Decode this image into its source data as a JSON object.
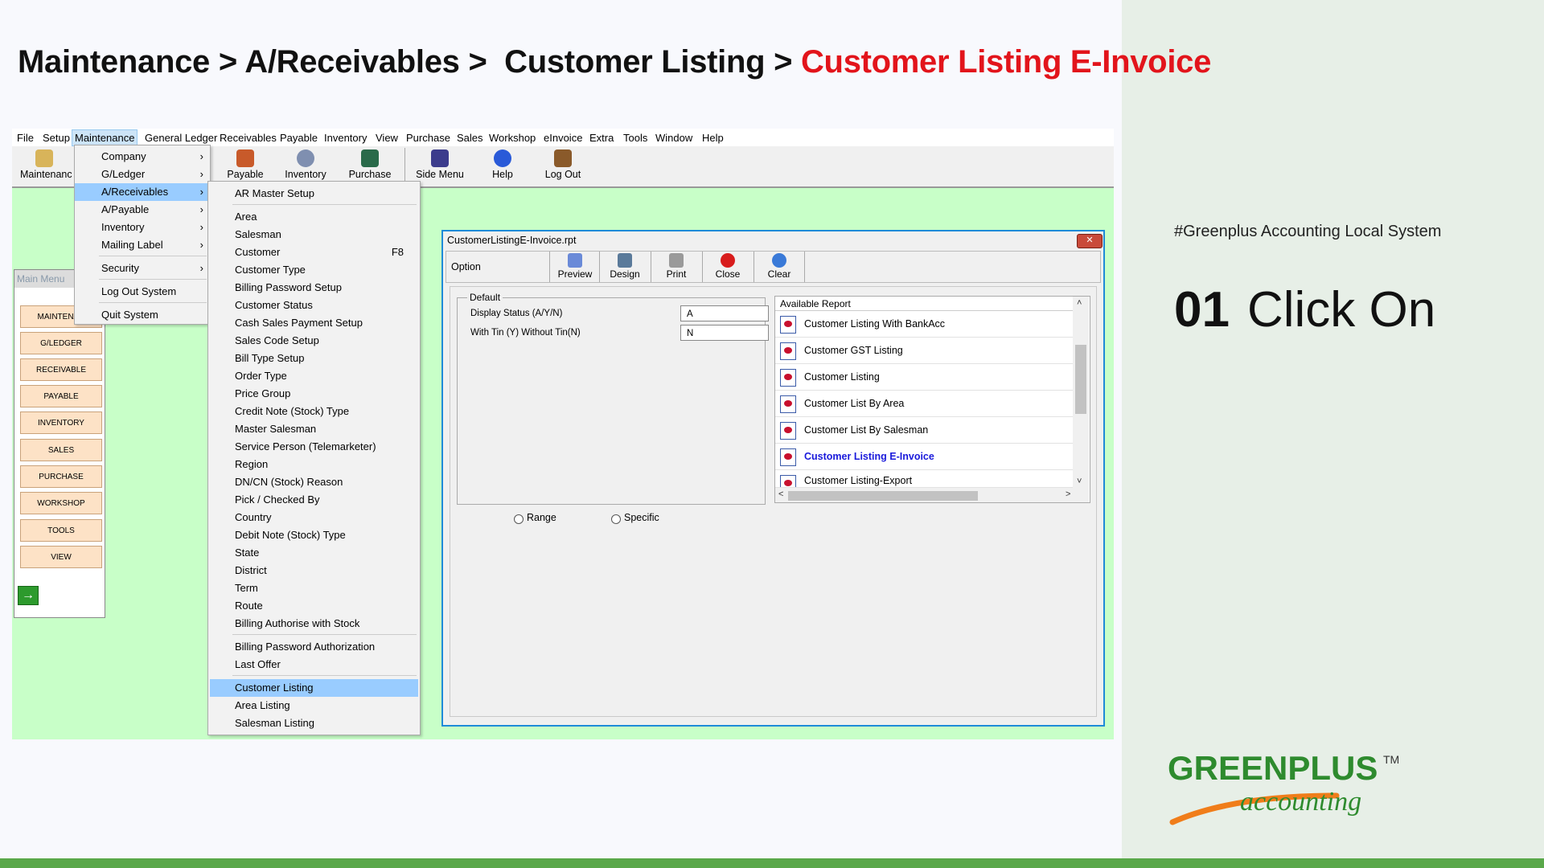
{
  "breadcrumb": {
    "p1": "Maintenance",
    "sep": ">",
    "p2": "A/Receivables",
    "p3": "Customer Listing",
    "current": "Customer Listing E-Invoice"
  },
  "side": {
    "hashtag": "#Greenplus Accounting Local System",
    "step_number": "01",
    "step_text": "Click On",
    "logo_text_top": "GREENPLUS",
    "logo_text_bottom": "accounting",
    "logo_tm": "TM"
  },
  "menubar": [
    "File",
    "Setup",
    "Maintenance",
    "General Ledger",
    "Receivables",
    "Payable",
    "Inventory",
    "View",
    "Purchase",
    "Sales",
    "Workshop",
    "eInvoice",
    "Extra",
    "Tools",
    "Window",
    "Help"
  ],
  "toolbar": [
    "Maintenanc",
    "Payable",
    "Inventory",
    "Purchase",
    "Side Menu",
    "Help",
    "Log Out"
  ],
  "main_menu": {
    "title": "Main Menu",
    "buttons": [
      "MAINTENAN",
      "G/LEDGER",
      "RECEIVABLE",
      "PAYABLE",
      "INVENTORY",
      "SALES",
      "PURCHASE",
      "WORKSHOP",
      "TOOLS",
      "VIEW"
    ],
    "go_icon": "arrow-right-icon"
  },
  "maintenance_menu": [
    "Company",
    "G/Ledger",
    "A/Receivables",
    "A/Payable",
    "Inventory",
    "Mailing Label",
    "Security",
    "Log Out System",
    "Quit System"
  ],
  "submenu_arrow": "›",
  "ar_menu": {
    "items": [
      "AR Master Setup",
      "Area",
      "Salesman",
      "Customer",
      "Customer Type",
      "Billing Password Setup",
      "Customer Status",
      "Cash Sales Payment Setup",
      "Sales Code Setup",
      "Bill Type Setup",
      "Order Type",
      "Price Group",
      "Credit Note (Stock) Type",
      "Master Salesman",
      "Service Person (Telemarketer)",
      "Region",
      "DN/CN (Stock) Reason",
      "Pick / Checked By",
      "Country",
      "Debit Note (Stock) Type",
      "State",
      "District",
      "Term",
      "Route",
      "Billing Authorise with Stock",
      "Billing Password Authorization",
      "Last Offer",
      "Customer Listing",
      "Area Listing",
      "Salesman Listing"
    ],
    "customer_shortcut": "F8"
  },
  "report_window": {
    "title": "CustomerListingE-Invoice.rpt",
    "close_symbol": "✕",
    "option_label": "Option",
    "buttons": [
      "Preview",
      "Design",
      "Print",
      "Close",
      "Clear"
    ],
    "default_label": "Default",
    "field1_label": "Display Status (A/Y/N)",
    "field1_value": "A",
    "field2_label": "With Tin (Y)  Without Tin(N)",
    "field2_value": "N",
    "available_header": "Available Report",
    "reports": [
      "Customer Listing With BankAcc",
      "Customer GST Listing",
      "Customer Listing",
      "Customer List By Area",
      "Customer List By Salesman",
      "Customer Listing E-Invoice",
      "Customer Listing-Export"
    ],
    "radio_range": "Range",
    "radio_specific": "Specific"
  },
  "colors": {
    "accent_red": "#e2141b",
    "green_brand": "#2e8b2e",
    "orange_brand": "#f07d1a",
    "app_bg": "#c8ffc8"
  }
}
